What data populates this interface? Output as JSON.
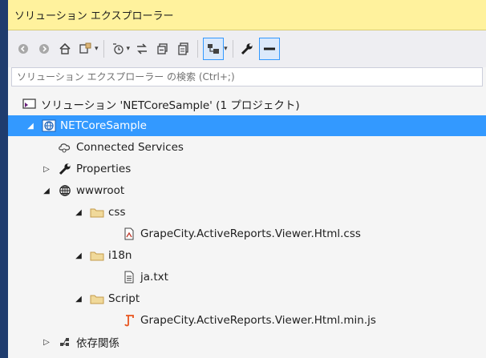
{
  "window": {
    "title": "ソリューション エクスプローラー"
  },
  "search": {
    "placeholder": "ソリューション エクスプローラー の検索 (Ctrl+;)"
  },
  "tree": {
    "solution": "ソリューション 'NETCoreSample' (1 プロジェクト)",
    "project": "NETCoreSample",
    "connected_services": "Connected Services",
    "properties": "Properties",
    "wwwroot": "wwwroot",
    "css_folder": "css",
    "css_file": "GrapeCity.ActiveReports.Viewer.Html.css",
    "i18n_folder": "i18n",
    "i18n_file": "ja.txt",
    "script_folder": "Script",
    "script_file": "GrapeCity.ActiveReports.Viewer.Html.min.js",
    "dependencies": "依存関係"
  },
  "colors": {
    "selection": "#3399ff",
    "title_bar": "#fff29d",
    "folder": "#dcb67a",
    "js_icon": "#e8541e"
  }
}
